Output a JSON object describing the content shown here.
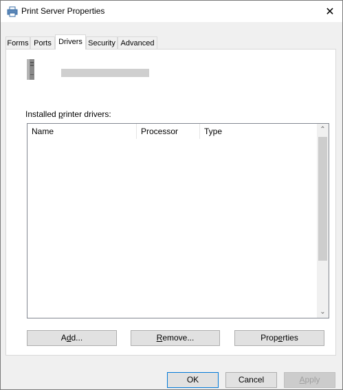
{
  "window": {
    "title": "Print Server Properties",
    "close_glyph": "✕",
    "title_icon": "printer-icon"
  },
  "tabs": [
    {
      "label": "Forms"
    },
    {
      "label": "Ports"
    },
    {
      "label": "Drivers",
      "active": true
    },
    {
      "label": "Security"
    },
    {
      "label": "Advanced"
    }
  ],
  "drivers_page": {
    "server_icon": "server-tower-icon",
    "installed_label": "Installed printer drivers:",
    "installed_label_accel": "p",
    "columns": [
      "Name",
      "Processor",
      "Type"
    ],
    "rows": [],
    "buttons": {
      "add": "Add...",
      "remove": "Remove...",
      "properties": "Properties"
    }
  },
  "footer": {
    "ok": "OK",
    "cancel": "Cancel",
    "apply": "Apply"
  }
}
